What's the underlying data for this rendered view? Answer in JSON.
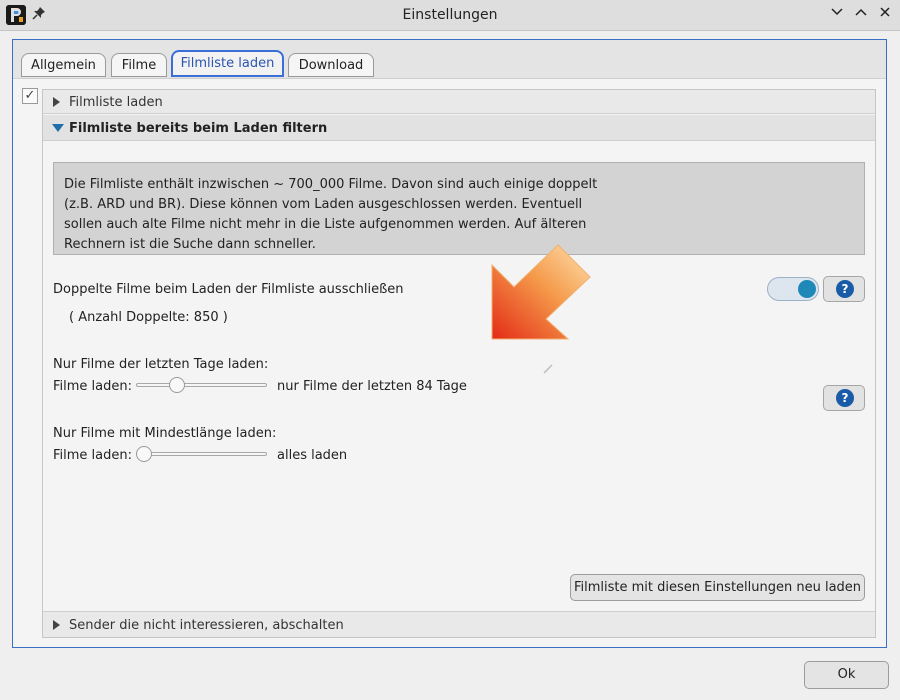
{
  "window": {
    "title": "Einstellungen",
    "icon": "app-logo-icon",
    "pin_icon": "pin-icon"
  },
  "tabs": [
    {
      "label": "Allgemein",
      "active": false
    },
    {
      "label": "Filme",
      "active": false
    },
    {
      "label": "Filmliste laden",
      "active": true
    },
    {
      "label": "Download",
      "active": false
    }
  ],
  "sections": {
    "filmliste_laden": "Filmliste laden",
    "filter": "Filmliste bereits beim Laden filtern",
    "sender": "Sender die nicht interessieren, abschalten"
  },
  "info": {
    "line1": "Die Filmliste enthält inzwischen ~ 700_000 Filme. Davon sind auch einige doppelt",
    "line2": "(z.B. ARD und BR). Diese können vom Laden ausgeschlossen werden. Eventuell",
    "line3": "sollen auch alte Filme nicht mehr in die Liste aufgenommen werden. Auf älteren",
    "line4": "Rechnern ist die Suche dann schneller."
  },
  "duplicates": {
    "label": "Doppelte Filme beim Laden der Filmliste ausschließen",
    "toggle_on": true,
    "count_text": "( Anzahl Doppelte: 850 )"
  },
  "days": {
    "heading": "Nur Filme der letzten Tage laden:",
    "label": "Filme laden:",
    "value_text": "nur Filme der letzten 84 Tage",
    "slider_fraction": 0.29
  },
  "length": {
    "heading": "Nur Filme mit Mindestlänge laden:",
    "label": "Filme laden:",
    "value_text": "alles laden",
    "slider_fraction": 0.0
  },
  "buttons": {
    "reload": "Filmliste mit diesen Einstellungen neu laden",
    "ok": "Ok",
    "help_symbol": "?"
  },
  "colors": {
    "accent": "#3b6fd8",
    "toggle": "#1e88b8",
    "help": "#1a5ba8",
    "arrow_start": "#f9c27a",
    "arrow_end": "#e8321a"
  }
}
